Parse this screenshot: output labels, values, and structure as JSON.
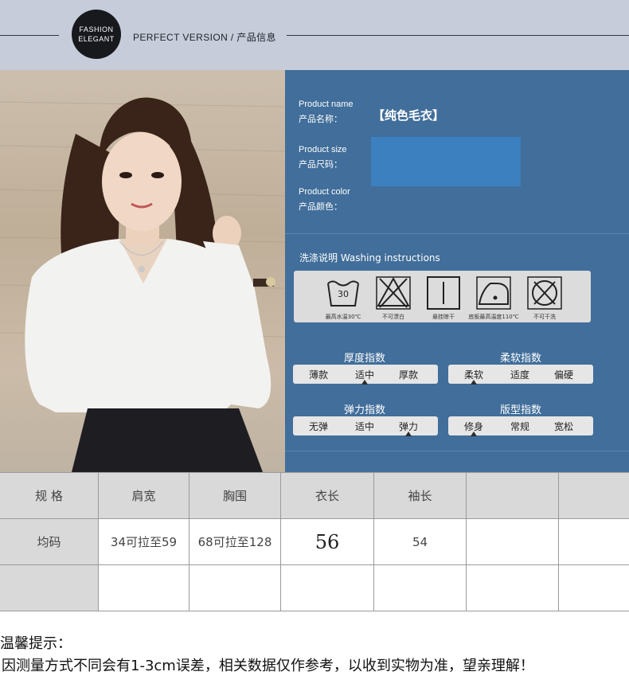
{
  "header": {
    "logo_line1": "FASHION",
    "logo_line2": "ELEGANT",
    "tagline": "PERFECT VERSION / 产品信息"
  },
  "product": {
    "name_en": "Product name",
    "name_zh": "产品名称：",
    "name_value": "【纯色毛衣】",
    "size_en": "Product size",
    "size_zh": "产品尺码：",
    "color_en": "Product color",
    "color_zh": "产品颜色：",
    "size_box_color": "#3c80c0"
  },
  "washing": {
    "title": "洗涤说明 Washing instructions",
    "icons": [
      {
        "icon": "wash-30-icon",
        "temp": "30",
        "caption": "最高水温30℃"
      },
      {
        "icon": "no-bleach-icon",
        "caption": "不可漂白"
      },
      {
        "icon": "hang-dry-icon",
        "caption": "悬挂晾干"
      },
      {
        "icon": "iron-110-icon",
        "caption": "底板最高温度110℃"
      },
      {
        "icon": "no-dry-clean-icon",
        "caption": "不可干洗"
      }
    ]
  },
  "indices": [
    {
      "title": "厚度指数",
      "options": [
        "薄款",
        "适中",
        "厚款"
      ],
      "selected": 1
    },
    {
      "title": "柔软指数",
      "options": [
        "柔软",
        "适度",
        "偏硬"
      ],
      "selected": 0
    },
    {
      "title": "弹力指数",
      "options": [
        "无弹",
        "适中",
        "弹力"
      ],
      "selected": 2
    },
    {
      "title": "版型指数",
      "options": [
        "修身",
        "常规",
        "宽松"
      ],
      "selected": 0
    }
  ],
  "size_table": {
    "headers": [
      "规 格",
      "肩宽",
      "胸围",
      "衣长",
      "袖长",
      "",
      ""
    ],
    "rows": [
      [
        "均码",
        "34可拉至59",
        "68可拉至128",
        "56",
        "54",
        "",
        ""
      ],
      [
        "",
        "",
        "",
        "",
        "",
        "",
        ""
      ]
    ]
  },
  "tips": {
    "title": "温馨提示：",
    "text": "因测量方式不同会有1-3cm误差，相关数据仅作参考，以收到实物为准，望亲理解！"
  },
  "colors": {
    "header_bg": "#c7ccdb",
    "info_bg": "#416e9a",
    "table_header_bg": "#d9d9d9"
  }
}
